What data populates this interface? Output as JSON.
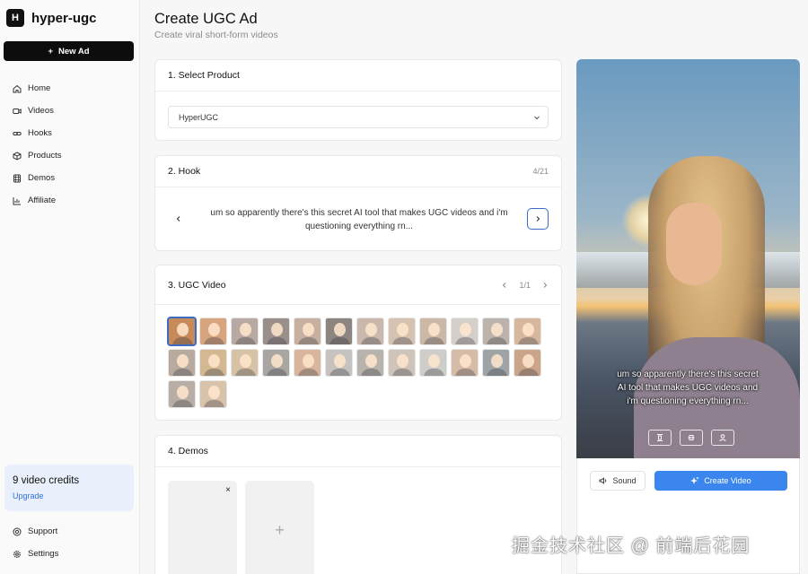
{
  "brand": {
    "logo_letter": "H",
    "name": "hyper-ugc"
  },
  "sidebar": {
    "new_ad_label": "New Ad",
    "items": [
      {
        "label": "Home",
        "icon": "home-icon"
      },
      {
        "label": "Videos",
        "icon": "video-icon"
      },
      {
        "label": "Hooks",
        "icon": "link-icon"
      },
      {
        "label": "Products",
        "icon": "box-icon"
      },
      {
        "label": "Demos",
        "icon": "film-icon"
      },
      {
        "label": "Affiliate",
        "icon": "bar-chart-icon"
      }
    ],
    "credits": {
      "count_label": "9 video credits",
      "upgrade_label": "Upgrade"
    },
    "bottom_items": [
      {
        "label": "Support",
        "icon": "help-icon"
      },
      {
        "label": "Settings",
        "icon": "gear-icon"
      }
    ]
  },
  "header": {
    "title": "Create UGC Ad",
    "subtitle": "Create viral short-form videos"
  },
  "product_card": {
    "title": "1. Select Product",
    "selected_value": "HyperUGC"
  },
  "hook_card": {
    "title": "2. Hook",
    "counter": "4/21",
    "text": "um so apparently there's this secret AI tool that makes UGC videos and i'm questioning everything rn..."
  },
  "ugc_card": {
    "title": "3. UGC Video",
    "page_label": "1/1",
    "avatar_colors": [
      [
        "#c98a5a",
        "#d8a47e",
        "#b8aaa2",
        "#9a8f8a",
        "#c7b0a0",
        "#8d857f",
        "#c9b8ab",
        "#d6c2b0",
        "#cbb8a6",
        "#d5cfca",
        "#bcb3ad",
        "#d6b89e"
      ],
      [
        "#b9aaa0",
        "#d3b891",
        "#d7c2a5",
        "#a9a5a3",
        "#d8b59c",
        "#c6c2bf",
        "#b8b3ad",
        "#cfc4ba",
        "#cfcdc9",
        "#d6bca6",
        "#9ea4a6",
        "#caa58a"
      ],
      [
        "#b8aea5",
        "#d9c2aa"
      ]
    ]
  },
  "demos_card": {
    "title": "4. Demos",
    "close_glyph": "×",
    "add_glyph": "+"
  },
  "preview": {
    "caption": "um so apparently there's this secret AI tool that makes UGC videos and i'm questioning everything rn...",
    "sound_label": "Sound",
    "create_label": "Create Video"
  },
  "watermark": "掘金技术社区 @ 前端后花园",
  "colors": {
    "accent": "#3a86ee",
    "selected_border": "#3c6bc4",
    "credits_bg": "#eaf0fb",
    "upgrade_link": "#2f6fdc"
  }
}
